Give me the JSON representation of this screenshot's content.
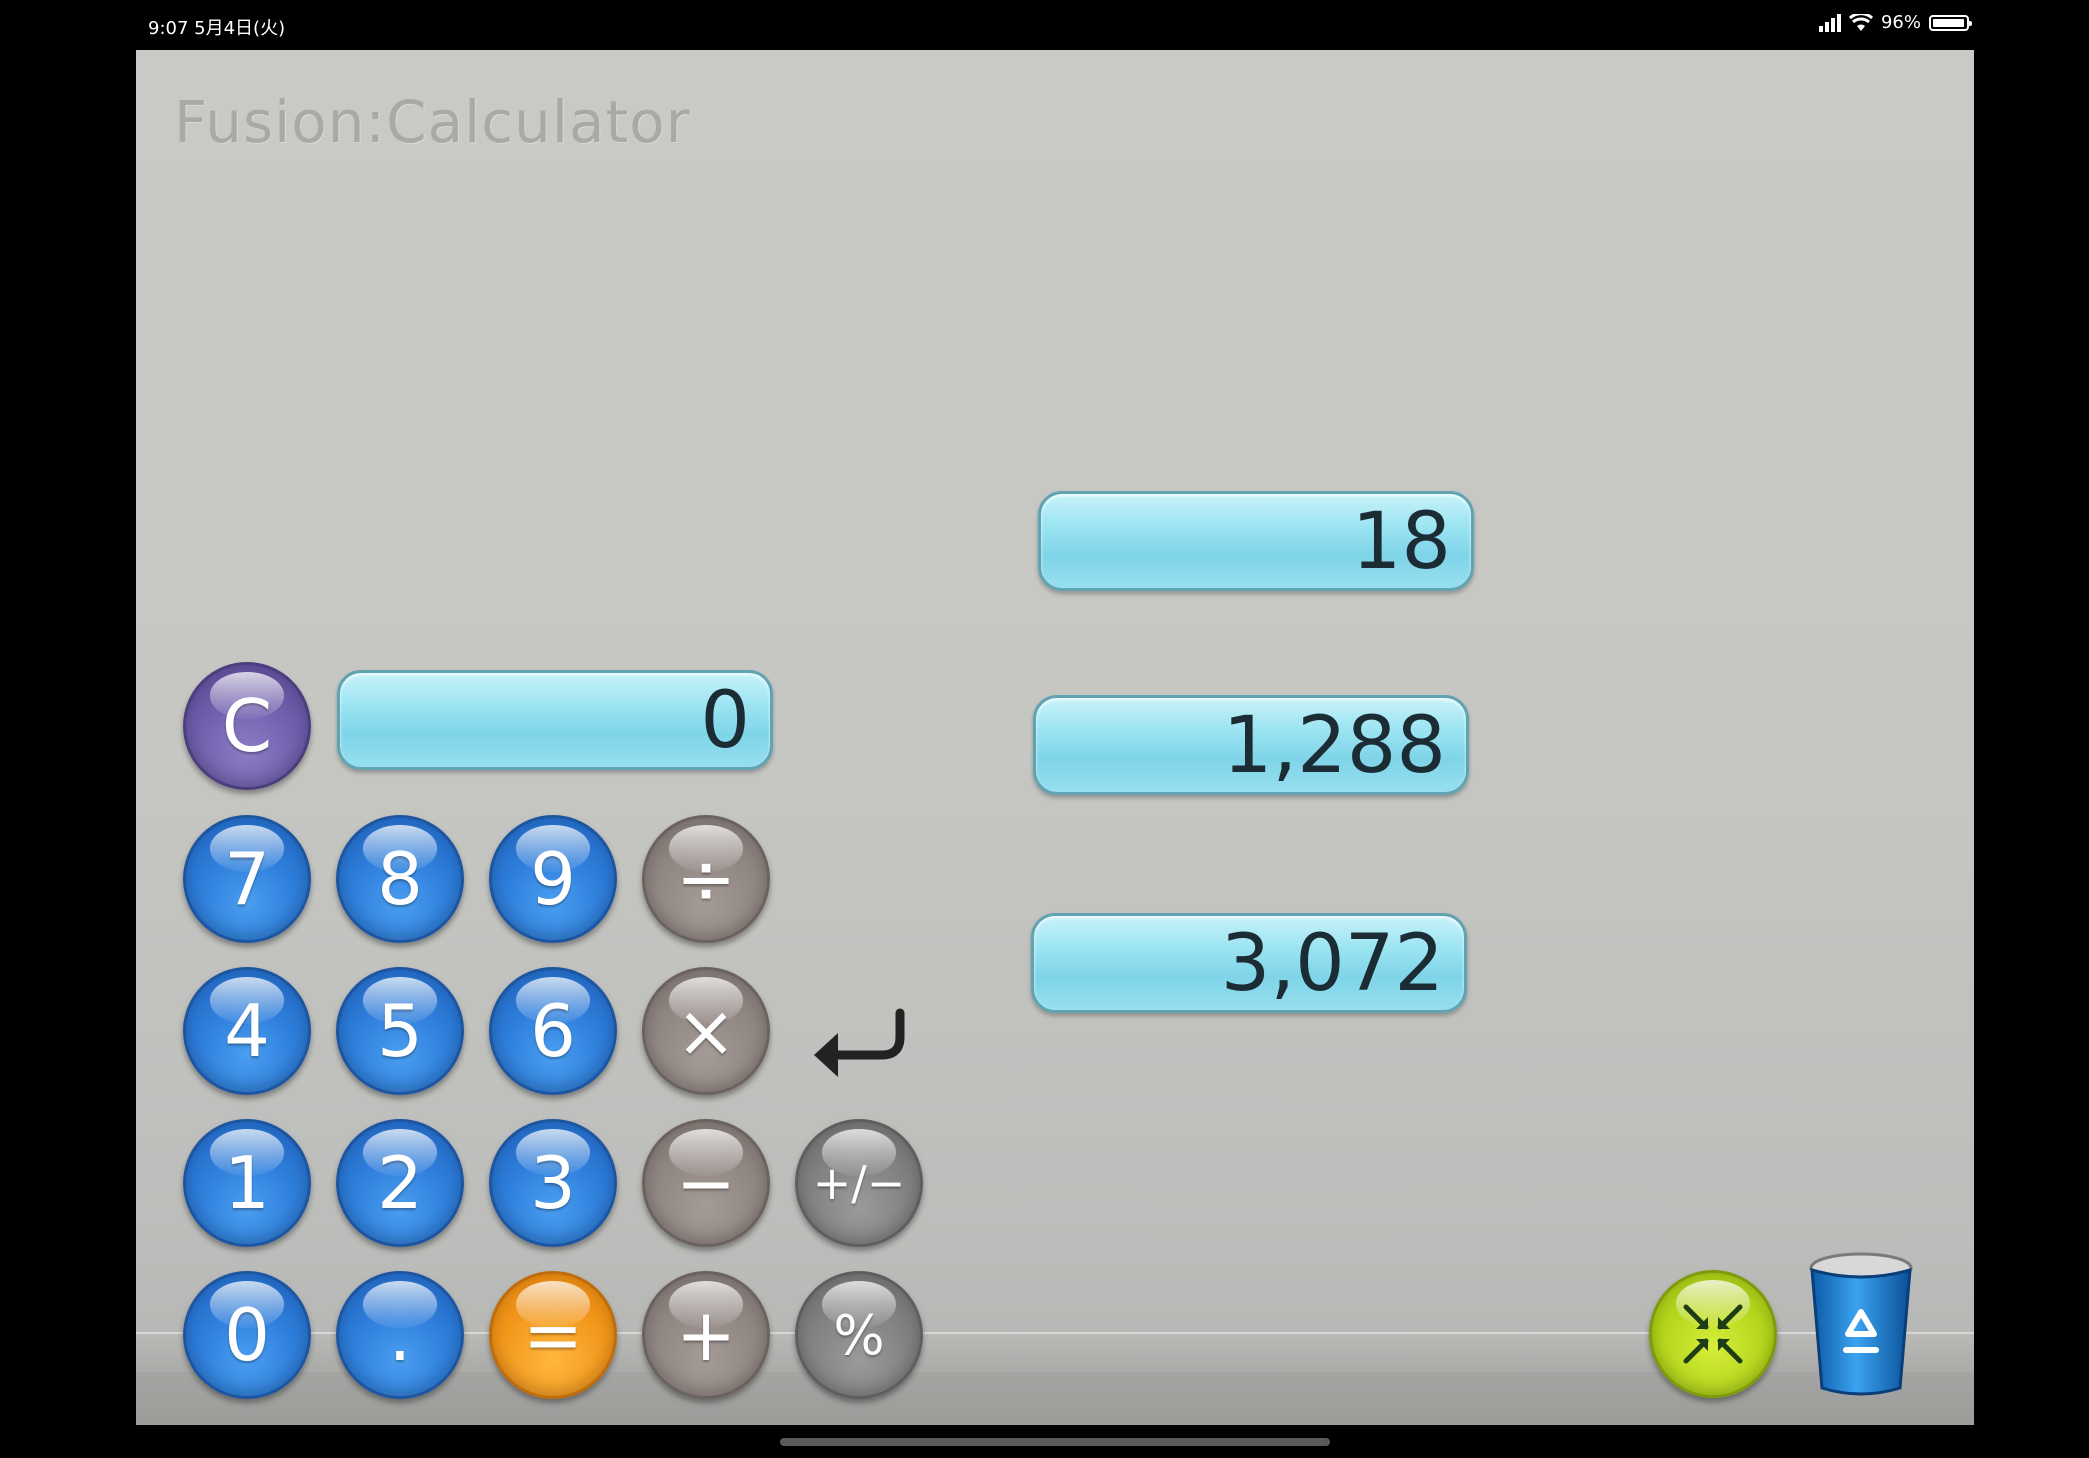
{
  "status_bar": {
    "time": "9:07  5月4日(火)",
    "battery": "96%",
    "battery_level": 0.96
  },
  "app": {
    "title": "Fusion:Calculator"
  },
  "entry_display": {
    "value": "0"
  },
  "history": [
    {
      "value": "18"
    },
    {
      "value": "1,288"
    },
    {
      "value": "3,072"
    }
  ],
  "keys": {
    "clear": "C",
    "seven": "7",
    "eight": "8",
    "nine": "9",
    "divide": "÷",
    "four": "4",
    "five": "5",
    "six": "6",
    "multiply": "×",
    "one": "1",
    "two": "2",
    "three": "3",
    "minus": "−",
    "plus_minus": "+/−",
    "zero": "0",
    "decimal": ".",
    "equals": "=",
    "plus": "+",
    "percent": "%"
  },
  "colors": {
    "display_accent": "#9be4f2",
    "digit_key": "#2f7fdc",
    "clear_key": "#6d5ba9",
    "operator_key": "#8e8480",
    "function_key": "#7f7f7f",
    "equals_key": "#f1951a",
    "compact_button": "#b4d51c"
  },
  "icons": {
    "undo": "undo-arrow-icon",
    "compact": "collapse-arrows-icon",
    "trash": "recycle-trash-icon"
  }
}
